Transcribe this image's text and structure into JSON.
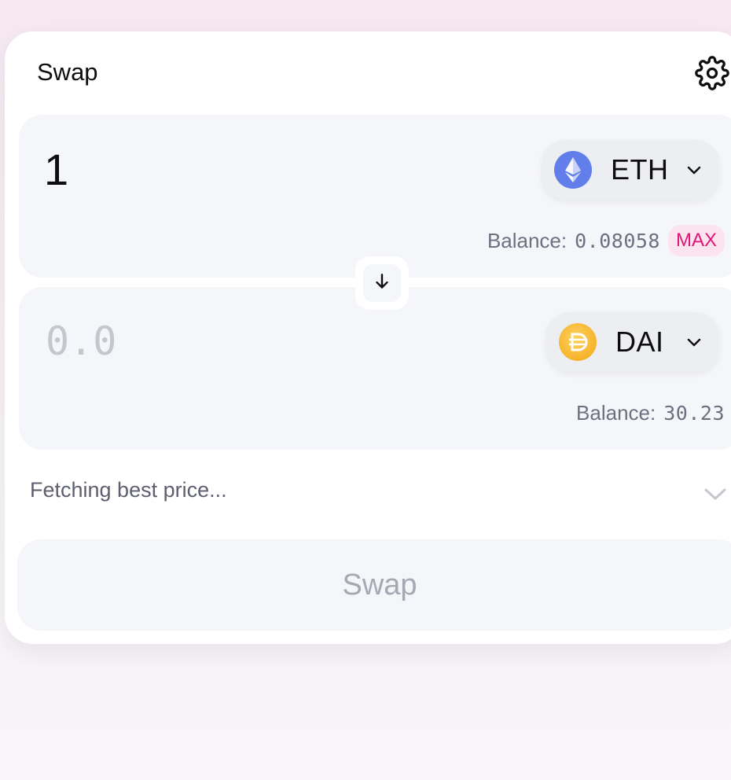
{
  "header": {
    "title": "Swap",
    "settings_icon": "gear-icon"
  },
  "from": {
    "amount": "1",
    "token": "ETH",
    "token_icon": "ethereum-icon",
    "balance_label": "Balance:",
    "balance_value": "0.08058",
    "max_label": "MAX"
  },
  "to": {
    "amount": "",
    "placeholder": "0.0",
    "token": "DAI",
    "token_icon": "dai-icon",
    "balance_label": "Balance:",
    "balance_value": "30.23"
  },
  "price": {
    "status": "Fetching best price..."
  },
  "action": {
    "swap_label": "Swap",
    "enabled": false
  },
  "colors": {
    "accent_max": "#e0167a",
    "max_bg": "#fce4ee",
    "eth": "#627eea",
    "dai": "#f5ac37"
  }
}
